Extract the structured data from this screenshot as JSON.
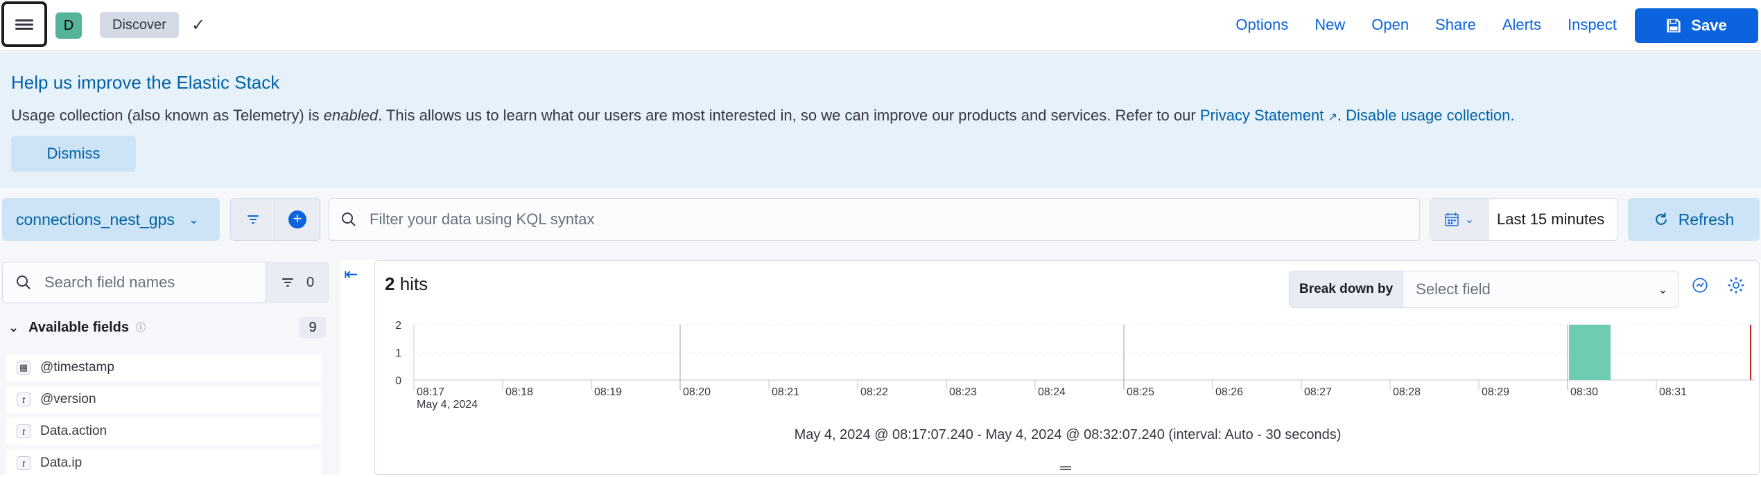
{
  "header": {
    "avatar_letter": "D",
    "breadcrumb": "Discover",
    "links": [
      "Options",
      "New",
      "Open",
      "Share",
      "Alerts",
      "Inspect"
    ],
    "save_label": "Save",
    "accent_color": "#0b64dd"
  },
  "callout": {
    "title": "Help us improve the Elastic Stack",
    "body_pre": "Usage collection (also known as Telemetry) is ",
    "body_em": "enabled",
    "body_post": ". This allows us to learn what our users are most interested in, so we can improve our products and services. Refer to our ",
    "privacy_link": "Privacy Statement",
    "disable_link": "Disable usage collection.",
    "dismiss_label": "Dismiss"
  },
  "toolbar": {
    "data_view": "connections_nest_gps",
    "query_placeholder": "Filter your data using KQL syntax",
    "time_range": "Last 15 minutes",
    "refresh_label": "Refresh"
  },
  "sidebar": {
    "search_placeholder": "Search field names",
    "filter_count": "0",
    "available_label": "Available fields",
    "available_count": "9",
    "fields": [
      {
        "name": "@timestamp",
        "type": "date"
      },
      {
        "name": "@version",
        "type": "t"
      },
      {
        "name": "Data.action",
        "type": "t"
      },
      {
        "name": "Data.ip",
        "type": "t"
      }
    ]
  },
  "main": {
    "hits_count": "2",
    "hits_label": "hits",
    "breakdown_label": "Break down by",
    "breakdown_placeholder": "Select field",
    "range_text": "May 4, 2024 @ 08:17:07.240 - May 4, 2024 @ 08:32:07.240 (interval: Auto - 30 seconds)"
  },
  "chart_data": {
    "type": "bar",
    "x_ticks": [
      "08:17",
      "08:18",
      "08:19",
      "08:20",
      "08:21",
      "08:22",
      "08:23",
      "08:24",
      "08:25",
      "08:26",
      "08:27",
      "08:28",
      "08:29",
      "08:30",
      "08:31"
    ],
    "x_date_label": "May 4, 2024",
    "y_ticks": [
      0,
      1,
      2
    ],
    "ylim": [
      0,
      2
    ],
    "bars": [
      {
        "x": "08:30:00",
        "value": 2
      }
    ],
    "bar_color": "#6dccb1",
    "now_marker_color": "#bd271e"
  }
}
